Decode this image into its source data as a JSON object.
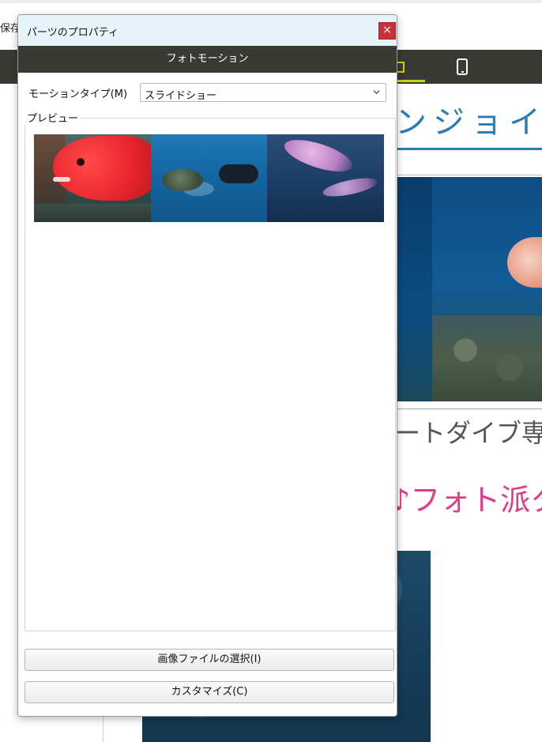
{
  "background": {
    "save_label": "保存",
    "heading_text": "ンジョイ",
    "subtitle_text": "ートダイブ専門",
    "pink_title_text": "♪フォト派タ"
  },
  "dialog": {
    "title": "パーツのプロパティ",
    "close_glyph": "×",
    "header": "フォトモーション",
    "motion_type_label": "モーションタイプ(M)",
    "motion_type_value": "スライドショー",
    "preview_label": "プレビュー",
    "select_images_button": "画像ファイルの選択(I)",
    "customize_button": "カスタマイズ(C)"
  },
  "colors": {
    "dark_bar": "#3a3a34",
    "titlebar": "#e6f3f9",
    "close_button": "#c9303a",
    "accent_blue": "#2a7db3",
    "accent_pink": "#e43a8a",
    "active_device": "#c8d400"
  }
}
